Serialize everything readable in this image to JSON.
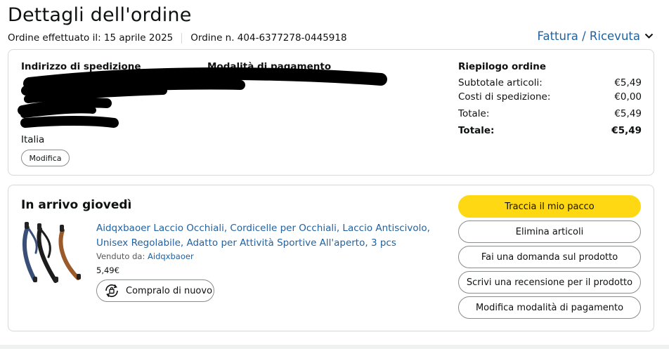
{
  "header": {
    "title": "Dettagli dell'ordine",
    "order_date": "Ordine effettuato il: 15 aprile 2025",
    "order_number": "Ordine n. 404-6377278-0445918",
    "invoice_link": "Fattura / Ricevuta"
  },
  "shipping": {
    "heading": "Indirizzo di spedizione",
    "country": "Italia",
    "edit_label": "Modifica"
  },
  "payment": {
    "heading": "Modalità di pagamento"
  },
  "summary": {
    "heading": "Riepilogo ordine",
    "rows": [
      {
        "label": "Subtotale articoli:",
        "value": "€5,49"
      },
      {
        "label": "Costi di spedizione:",
        "value": "€0,00"
      },
      {
        "label": "Totale:",
        "value": "€5,49"
      },
      {
        "label": "Totale:",
        "value": "€5,49"
      }
    ]
  },
  "shipment": {
    "status": "In arrivo giovedì",
    "product": {
      "title": "Aidqxbaoer Laccio Occhiali, Cordicelle per Occhiali, Laccio Antiscivolo, Unisex Regolabile, Adatto per Attività Sportive All'aperto, 3 pcs",
      "sold_by_label": "Venduto da:",
      "seller": "Aidqxbaoer",
      "price": "5,49€",
      "buy_again": "Compralo di nuovo"
    },
    "actions": [
      "Traccia il mio pacco",
      "Elimina articoli",
      "Fai una domanda sul prodotto",
      "Scrivi una recensione per il prodotto",
      "Modifica modalità di pagamento"
    ]
  },
  "colors": {
    "link": "#2162a1",
    "primary_button": "#ffd814",
    "border": "#d5d9d9"
  }
}
